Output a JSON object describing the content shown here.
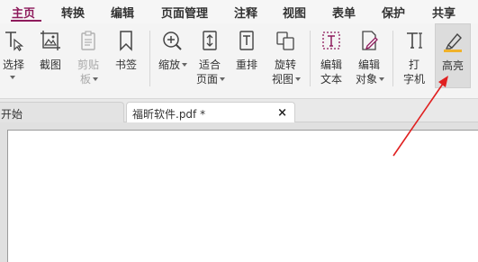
{
  "menu": {
    "items": [
      "主页",
      "转换",
      "编辑",
      "页面管理",
      "注释",
      "视图",
      "表单",
      "保护",
      "共享"
    ],
    "active_index": 0,
    "accent_color": "#8e1b5c"
  },
  "ribbon": {
    "tools": [
      {
        "id": "select",
        "label": "选择",
        "icon": "text-cursor-icon",
        "dropdown": true
      },
      {
        "id": "screenshot",
        "label": "截图",
        "icon": "image-crop-icon",
        "dropdown": false
      },
      {
        "id": "clipboard",
        "label_line1": "剪贴",
        "label_line2": "板",
        "icon": "clipboard-icon",
        "dropdown": true,
        "disabled": true
      },
      {
        "id": "bookmark",
        "label": "书签",
        "icon": "bookmark-icon",
        "dropdown": false
      },
      {
        "id": "zoom",
        "label": "缩放",
        "icon": "zoom-in-icon",
        "dropdown": true
      },
      {
        "id": "fit-page",
        "label_line1": "适合",
        "label_line2": "页面",
        "icon": "fit-page-icon",
        "dropdown": true
      },
      {
        "id": "reflow",
        "label": "重排",
        "icon": "reflow-icon",
        "dropdown": false
      },
      {
        "id": "rotate",
        "label_line1": "旋转",
        "label_line2": "视图",
        "icon": "rotate-view-icon",
        "dropdown": true
      },
      {
        "id": "edit-text",
        "label_line1": "编辑",
        "label_line2": "文本",
        "icon": "edit-text-icon",
        "dropdown": false
      },
      {
        "id": "edit-object",
        "label_line1": "编辑",
        "label_line2": "对象",
        "icon": "edit-object-icon",
        "dropdown": true
      },
      {
        "id": "typewriter",
        "label_line1": "打",
        "label_line2": "字机",
        "icon": "typewriter-icon",
        "dropdown": false
      },
      {
        "id": "highlight",
        "label": "高亮",
        "icon": "highlighter-icon",
        "dropdown": false,
        "selected": true
      }
    ]
  },
  "tabs": [
    {
      "label": "开始",
      "active": false
    },
    {
      "label": "福昕软件.pdf *",
      "active": true,
      "close_symbol": "×"
    }
  ],
  "annotation": {
    "color": "#e02020"
  }
}
